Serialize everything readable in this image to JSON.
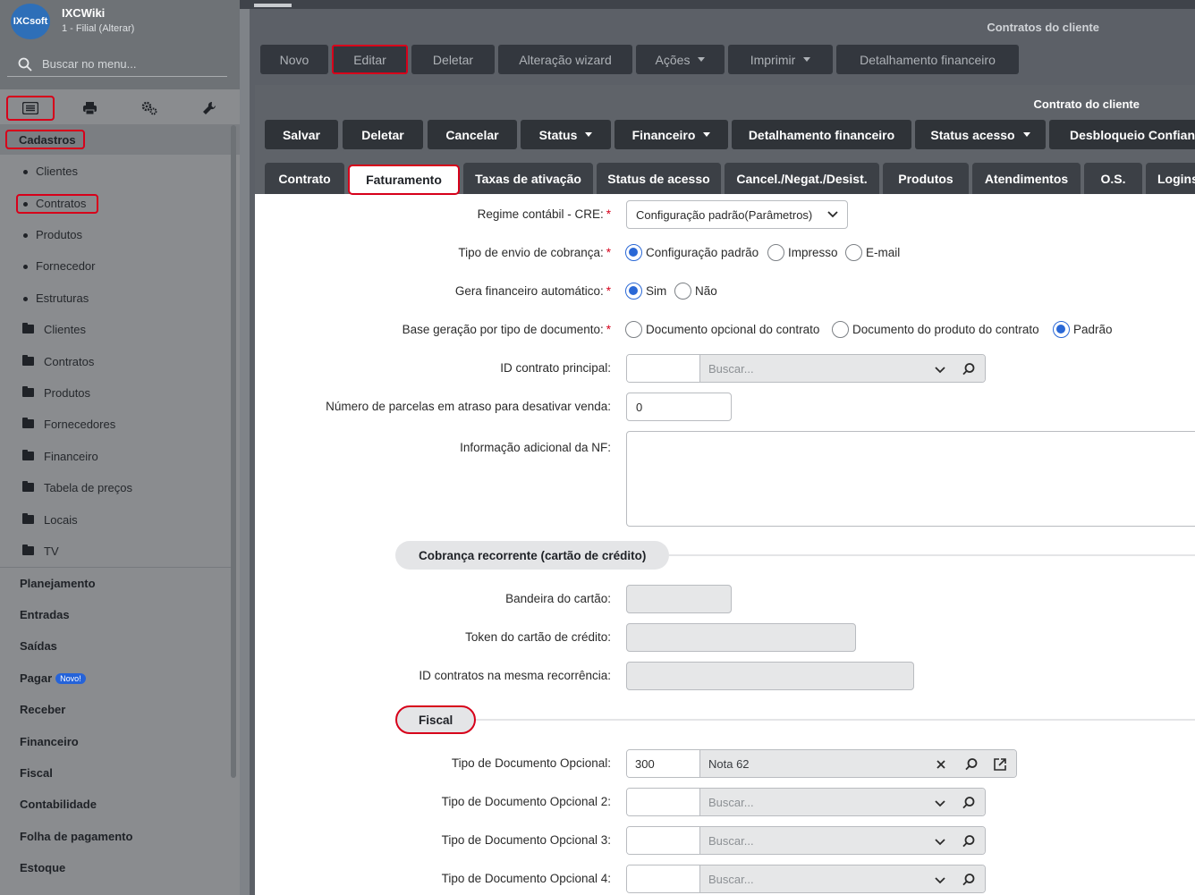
{
  "app": {
    "logo_text": "IXCsoft",
    "title": "IXCWiki",
    "subtitle": "1 - Filial (Alterar)"
  },
  "sidebar": {
    "search_placeholder": "Buscar no menu...",
    "icons": [
      "list-icon",
      "printer-icon",
      "gears-icon",
      "wrench-icon"
    ],
    "section_title": "Cadastros",
    "items": [
      {
        "label": "Clientes",
        "kind": "page"
      },
      {
        "label": "Contratos",
        "kind": "page"
      },
      {
        "label": "Produtos",
        "kind": "page"
      },
      {
        "label": "Fornecedor",
        "kind": "page"
      },
      {
        "label": "Estruturas",
        "kind": "page"
      },
      {
        "label": "Clientes",
        "kind": "folder"
      },
      {
        "label": "Contratos",
        "kind": "folder"
      },
      {
        "label": "Produtos",
        "kind": "folder"
      },
      {
        "label": "Fornecedores",
        "kind": "folder"
      },
      {
        "label": "Financeiro",
        "kind": "folder"
      },
      {
        "label": "Tabela de preços",
        "kind": "folder"
      },
      {
        "label": "Locais",
        "kind": "folder"
      },
      {
        "label": "TV",
        "kind": "folder"
      }
    ],
    "sections": [
      {
        "label": "Planejamento"
      },
      {
        "label": "Entradas"
      },
      {
        "label": "Saídas"
      },
      {
        "label": "Pagar",
        "badge": "Novo!"
      },
      {
        "label": "Receber"
      },
      {
        "label": "Financeiro"
      },
      {
        "label": "Fiscal"
      },
      {
        "label": "Contabilidade"
      },
      {
        "label": "Folha de pagamento"
      },
      {
        "label": "Estoque"
      }
    ]
  },
  "outer_window": {
    "title": "Contratos do cliente",
    "buttons": [
      "Novo",
      "Editar",
      "Deletar",
      "Alteração wizard",
      "Ações",
      "Imprimir",
      "Detalhamento financeiro"
    ]
  },
  "inner_window": {
    "title": "Contrato do cliente",
    "buttons": [
      "Salvar",
      "Deletar",
      "Cancelar",
      "Status",
      "Financeiro",
      "Detalhamento financeiro",
      "Status acesso",
      "Desbloqueio Confiança"
    ],
    "tabs": [
      "Contrato",
      "Faturamento",
      "Taxas de ativação",
      "Status de acesso",
      "Cancel./Negat./Desist.",
      "Produtos",
      "Atendimentos",
      "O.S.",
      "Logins"
    ]
  },
  "form": {
    "regime": {
      "label": "Regime contábil - CRE:",
      "value": "Configuração padrão(Parâmetros)"
    },
    "tipo_envio": {
      "label": "Tipo de envio de cobrança:",
      "options": [
        "Configuração padrão",
        "Impresso",
        "E-mail"
      ],
      "selected": "Configuração padrão"
    },
    "gera_financeiro": {
      "label": "Gera financeiro automático:",
      "options": [
        "Sim",
        "Não"
      ],
      "selected": "Sim"
    },
    "base_geracao": {
      "label": "Base geração por tipo de documento:",
      "options": [
        "Documento opcional do contrato",
        "Documento do produto do contrato",
        "Padrão"
      ],
      "selected": "Padrão"
    },
    "id_contrato_principal": {
      "label": "ID contrato principal:",
      "code": "",
      "placeholder": "Buscar..."
    },
    "num_parcelas": {
      "label": "Número de parcelas em atraso para desativar venda:",
      "value": "0"
    },
    "info_nf": {
      "label": "Informação adicional da NF:",
      "value": ""
    },
    "recorrente_section": "Cobrança recorrente (cartão de crédito)",
    "bandeira": {
      "label": "Bandeira do cartão:"
    },
    "token": {
      "label": "Token do cartão de crédito:"
    },
    "id_contratos_recorrencia": {
      "label": "ID contratos na mesma recorrência:"
    },
    "fiscal_section": "Fiscal",
    "doc1": {
      "label": "Tipo de Documento Opcional:",
      "code": "300",
      "desc": "Nota 62"
    },
    "doc2": {
      "label": "Tipo de Documento Opcional 2:",
      "code": "",
      "placeholder": "Buscar..."
    },
    "doc3": {
      "label": "Tipo de Documento Opcional 3:",
      "code": "",
      "placeholder": "Buscar..."
    },
    "doc4": {
      "label": "Tipo de Documento Opcional 4:",
      "code": "",
      "placeholder": "Buscar..."
    }
  },
  "colors": {
    "highlight": "#d7001a",
    "accent": "#2a68d6",
    "badge": "#2563d9"
  }
}
